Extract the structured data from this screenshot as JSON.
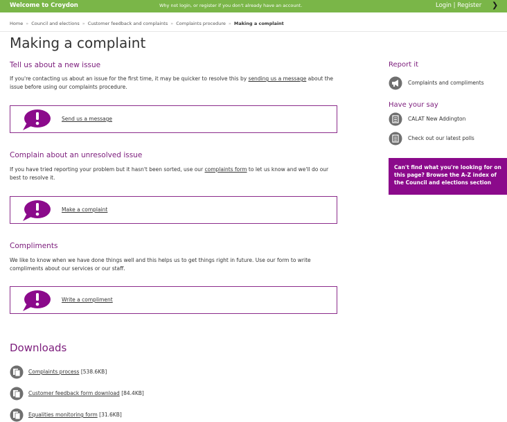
{
  "topbar": {
    "brand": "Welcome to Croydon",
    "notice": "Why not login, or register if you don't already have an account.",
    "login_links": "Login | Register",
    "colors": {
      "bar": "#7ab648"
    }
  },
  "breadcrumb": {
    "items": [
      "Home",
      "Council and elections",
      "Customer feedback and complaints",
      "Complaints procedure"
    ],
    "current": "Making a complaint",
    "separator": "»"
  },
  "page": {
    "title": "Making a complaint"
  },
  "sections": [
    {
      "heading": "Tell us about a new issue",
      "text_before": "If you're contacting us about an issue for the first time, it may be quicker to resolve this by ",
      "link": "sending us a message",
      "text_after": " about the issue before using our complaints procedure.",
      "cta": "Send us a message"
    },
    {
      "heading": "Complain about an unresolved issue",
      "text_before": "If you have tried reporting your problem but it hasn't been sorted, use our ",
      "link": "complaints form",
      "text_after": " to let us know and we'll do our best to resolve it.",
      "cta": "Make a complaint"
    },
    {
      "heading": "Compliments",
      "text": "We like to know when we have done things well and this helps us to get things right in future. Use our form to write compliments about our services or our staff.",
      "cta": "Write a compliment"
    }
  ],
  "downloads": {
    "title": "Downloads",
    "items": [
      {
        "name": "Complaints process",
        "size": "[538.6KB]"
      },
      {
        "name": "Customer feedback form download",
        "size": "[84.4KB]"
      },
      {
        "name": "Equalities monitoring form",
        "size": "[31.6KB]"
      }
    ]
  },
  "sidebar": {
    "report_heading": "Report it",
    "report_item": "Complaints and compliments",
    "say_heading": "Have your say",
    "say_items": [
      "CALAT New Addington",
      "Check out our latest polls"
    ],
    "promo": "Can't find what you're looking for on this page? Browse the A-Z index of the Council and elections section"
  },
  "colors": {
    "accent": "#7b1b7b",
    "promo": "#8b0a8b",
    "icon_grey": "#6f6f6f"
  },
  "icons": [
    "chevron-right-icon",
    "speech-bubble-exclamation-icon",
    "document-icon",
    "megaphone-icon",
    "list-icon"
  ]
}
